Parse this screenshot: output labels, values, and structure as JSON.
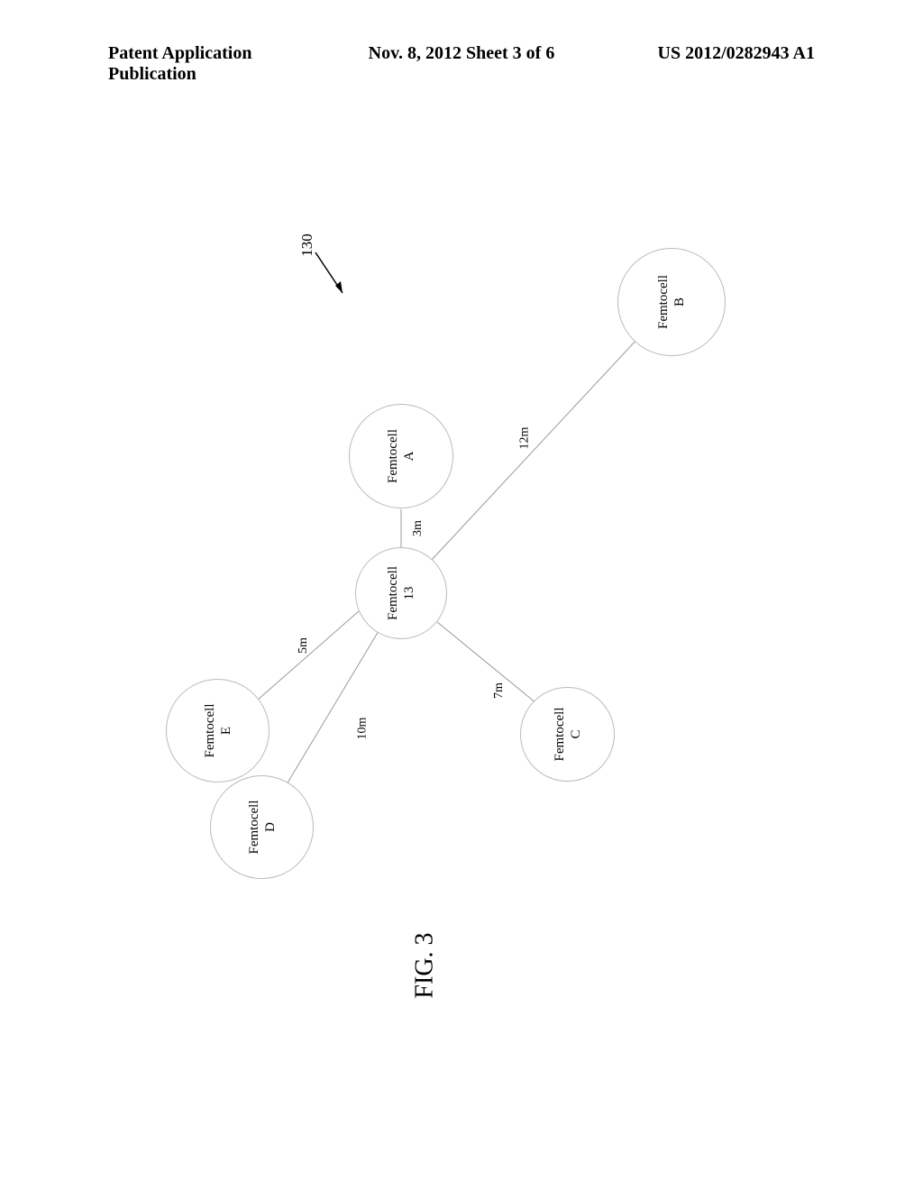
{
  "header": {
    "left": "Patent Application Publication",
    "center": "Nov. 8, 2012  Sheet 3 of 6",
    "right": "US 2012/0282943 A1"
  },
  "diagram": {
    "reference": "130",
    "figure_label": "FIG. 3",
    "nodes": {
      "center": {
        "line1": "Femtocell",
        "line2": "13"
      },
      "a": {
        "line1": "Femtocell",
        "line2": "A"
      },
      "b": {
        "line1": "Femtocell",
        "line2": "B"
      },
      "c": {
        "line1": "Femtocell",
        "line2": "C"
      },
      "d": {
        "line1": "Femtocell",
        "line2": "D"
      },
      "e": {
        "line1": "Femtocell",
        "line2": "E"
      }
    },
    "edges": {
      "a": "3m",
      "b": "12m",
      "c": "7m",
      "d": "10m",
      "e": "5m"
    }
  }
}
